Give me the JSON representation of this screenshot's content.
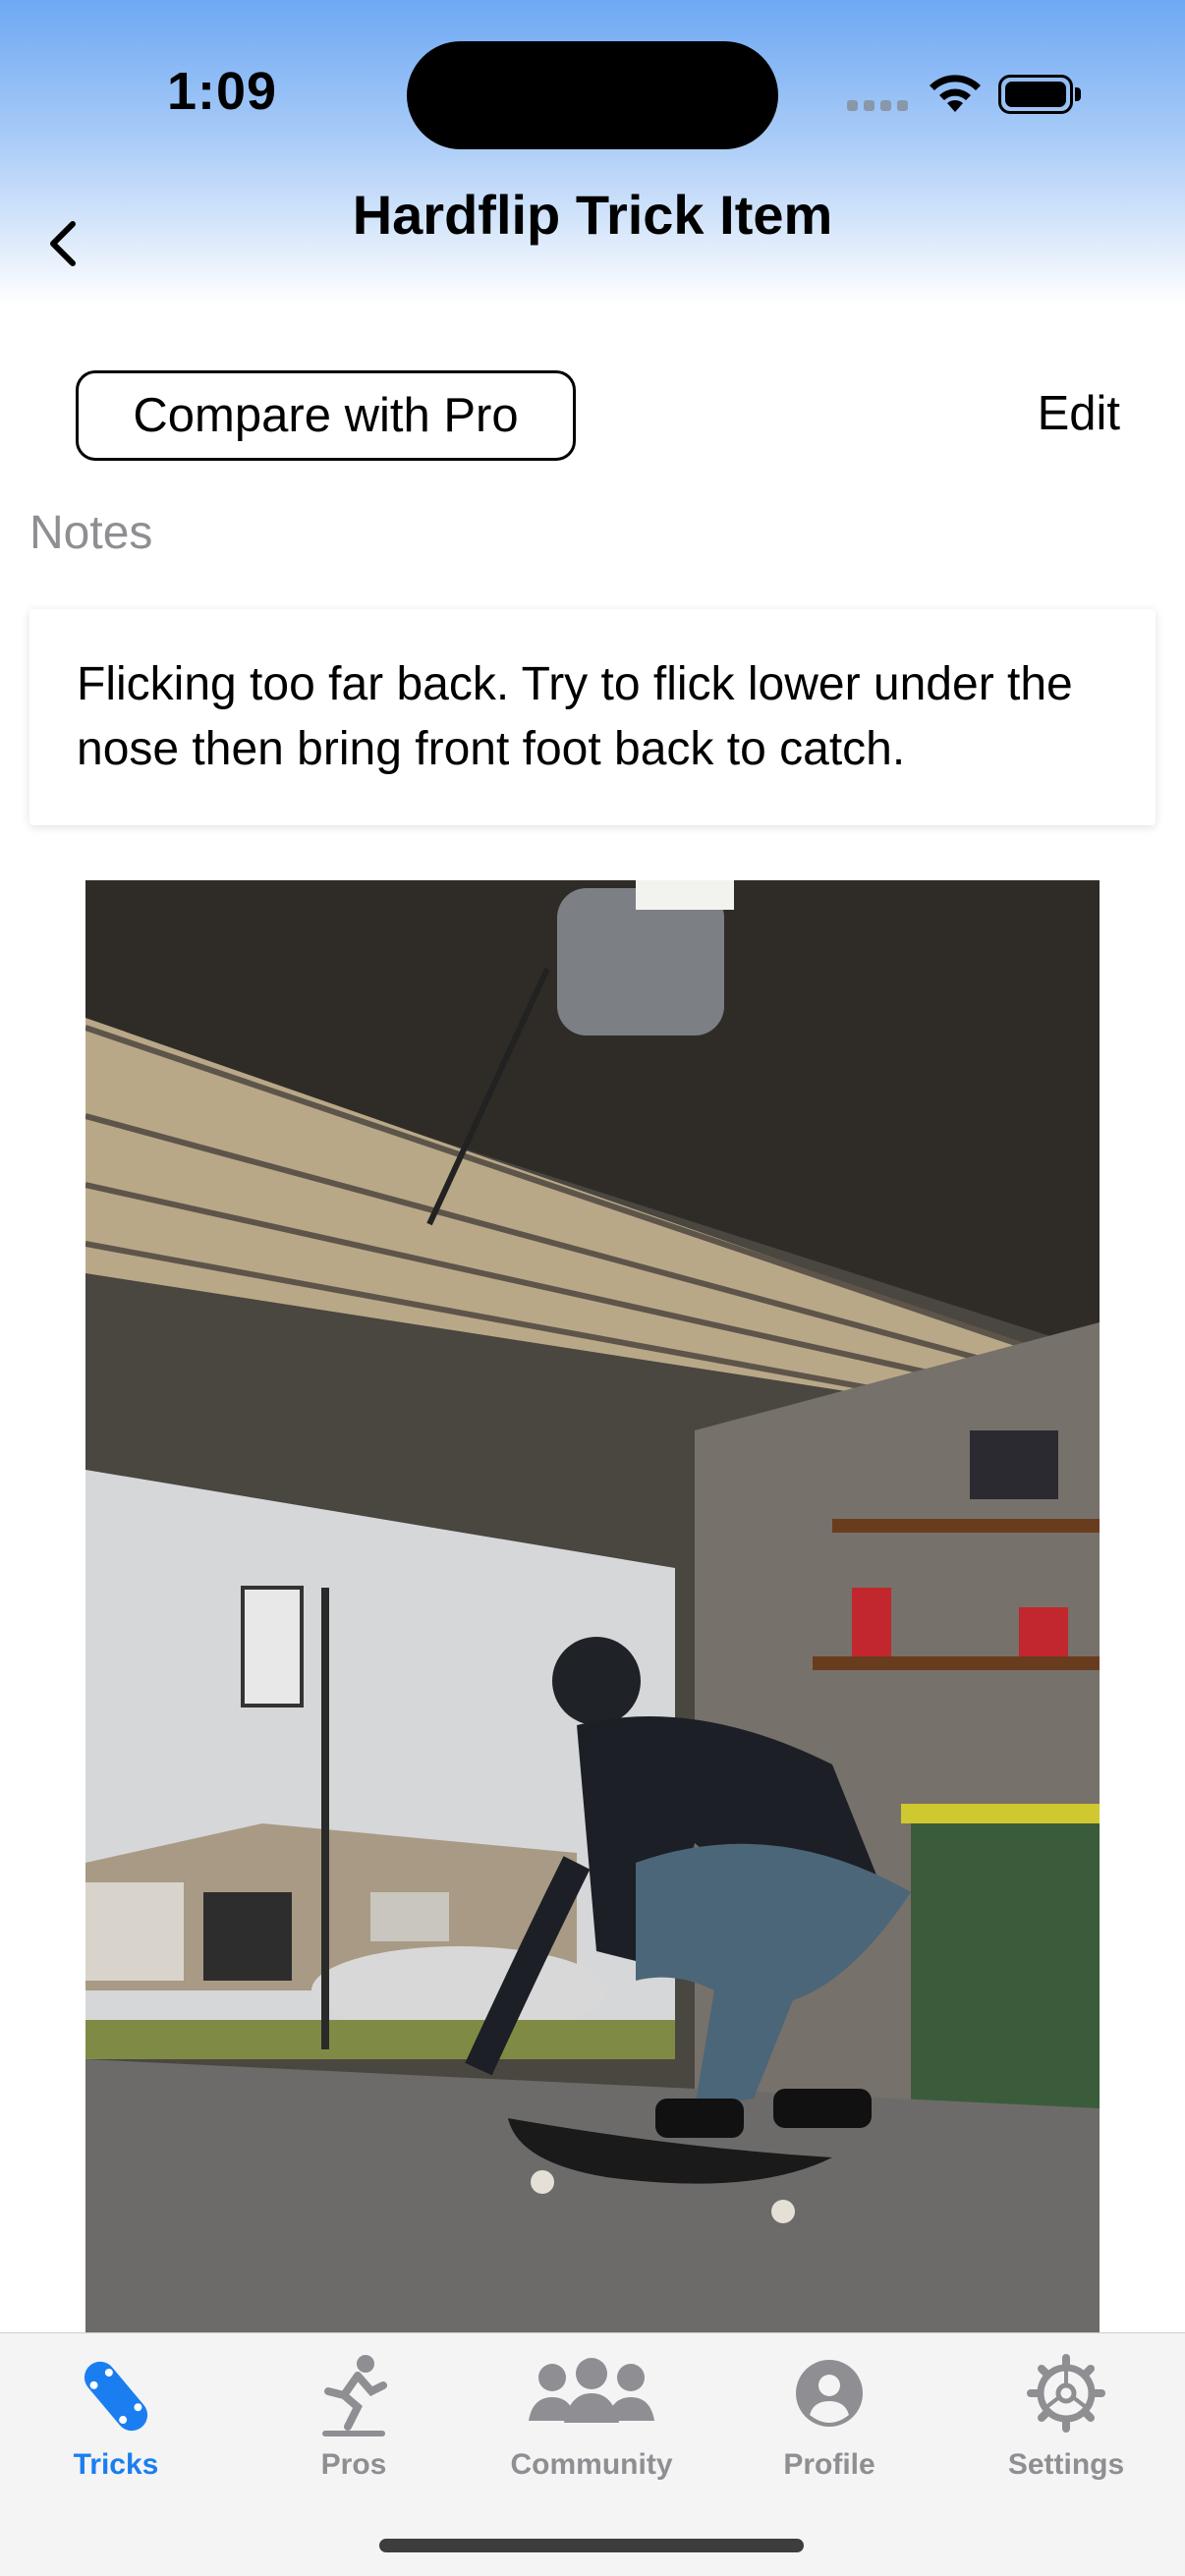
{
  "status_bar": {
    "time": "1:09"
  },
  "nav": {
    "title": "Hardflip Trick Item",
    "back_icon": "chevron-left-icon"
  },
  "actions": {
    "compare_label": "Compare with Pro",
    "edit_label": "Edit"
  },
  "notes": {
    "label": "Notes",
    "text": "Flicking too far back. Try to flick lower under the nose then bring front foot back to catch."
  },
  "video": {
    "content": "skateboarder in garage attempting hardflip"
  },
  "tabs": [
    {
      "label": "Tricks",
      "icon": "skateboard-icon",
      "active": true
    },
    {
      "label": "Pros",
      "icon": "skater-icon",
      "active": false
    },
    {
      "label": "Community",
      "icon": "group-icon",
      "active": false
    },
    {
      "label": "Profile",
      "icon": "person-circle-icon",
      "active": false
    },
    {
      "label": "Settings",
      "icon": "gear-icon",
      "active": false
    }
  ],
  "colors": {
    "accent": "#1a7ef0",
    "inactive": "#8e8e93",
    "header_top": "#6ea8f4"
  }
}
